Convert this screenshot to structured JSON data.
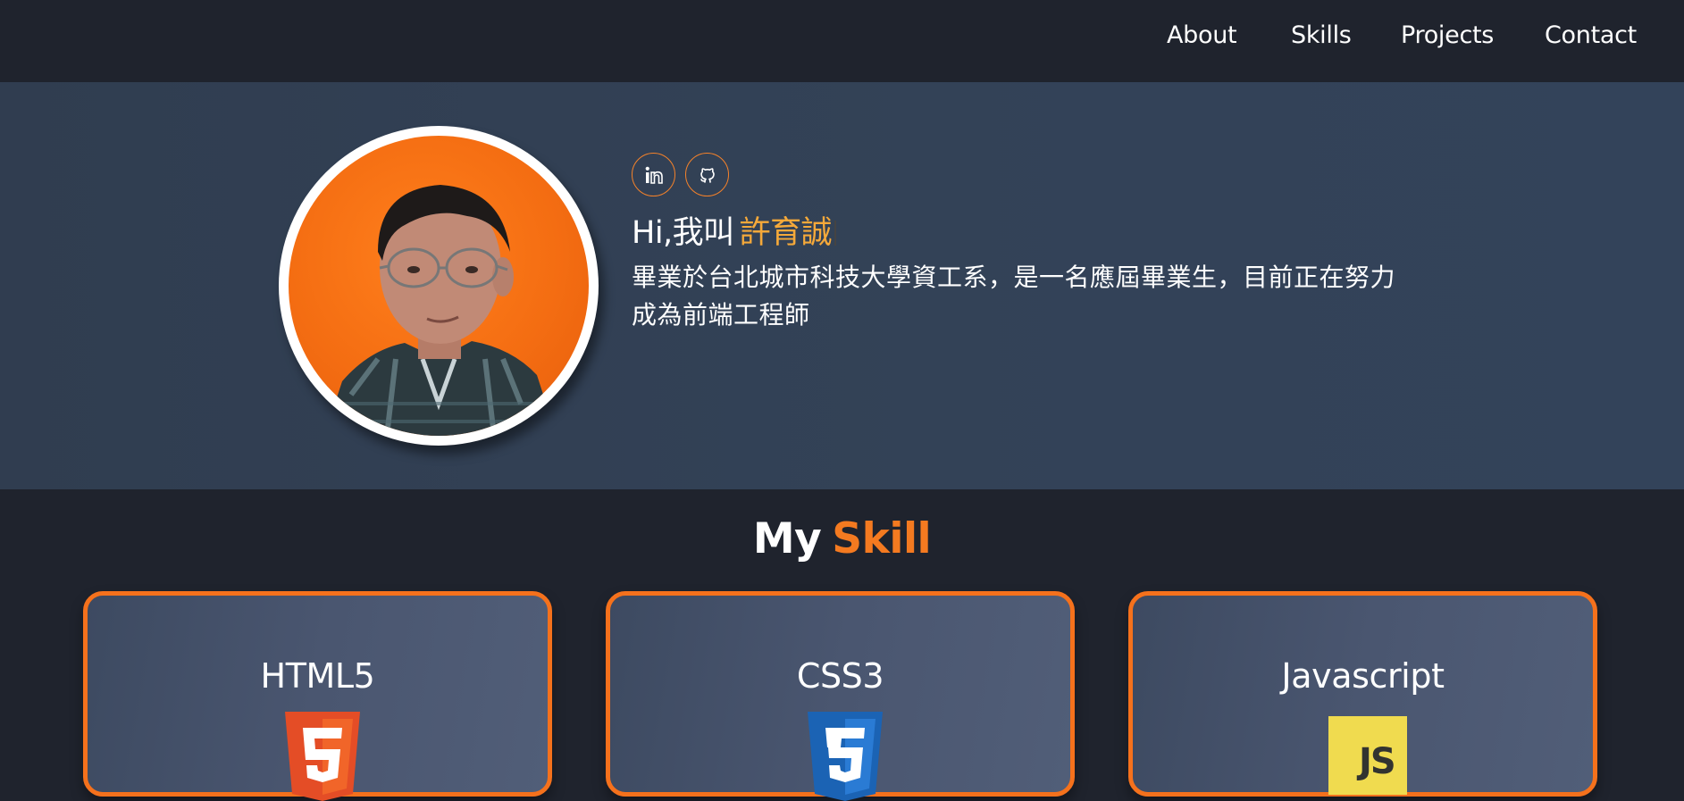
{
  "nav": {
    "links": [
      {
        "label": "About"
      },
      {
        "label": "Skills"
      },
      {
        "label": "Projects"
      },
      {
        "label": "Contact"
      }
    ]
  },
  "hero": {
    "greeting_prefix": "Hi,我叫",
    "name": "許育誠",
    "intro": "畢業於台北城市科技大學資工系，是一名應屆畢業生，目前正在努力成為前端工程師",
    "social": [
      {
        "icon": "linkedin-icon"
      },
      {
        "icon": "github-icon"
      }
    ],
    "avatar_bg": "#f46d12",
    "accent": "#f5a93a"
  },
  "skills": {
    "title_prefix": "My",
    "title_highlight": "Skill",
    "cards": [
      {
        "title": "HTML5",
        "icon": "html5-icon",
        "color": "#e44d26"
      },
      {
        "title": "CSS3",
        "icon": "css3-icon",
        "color": "#1b63b4"
      },
      {
        "title": "Javascript",
        "icon": "javascript-icon",
        "color": "#f0db4f",
        "icon_text": "JS"
      }
    ]
  }
}
